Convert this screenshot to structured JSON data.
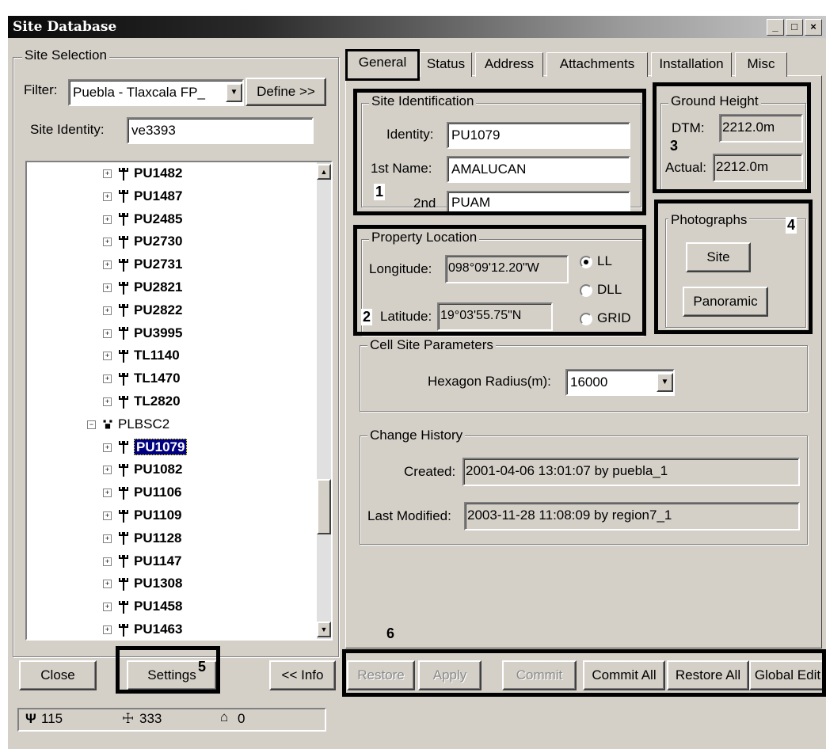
{
  "window": {
    "title": "Site Database"
  },
  "site_selection": {
    "group_label": "Site Selection",
    "filter_label": "Filter:",
    "filter_value": "Puebla - Tlaxcala FP_",
    "define_label": "Define >>",
    "identity_label": "Site Identity:",
    "identity_value": "ve3393"
  },
  "tree": {
    "items_top": [
      "PU1482",
      "PU1487",
      "PU2485",
      "PU2730",
      "PU2731",
      "PU2821",
      "PU2822",
      "PU3995",
      "TL1140",
      "TL1470",
      "TL2820"
    ],
    "parent": "PLBSC2",
    "selected": "PU1079",
    "items_bottom": [
      "PU1082",
      "PU1106",
      "PU1109",
      "PU1128",
      "PU1147",
      "PU1308",
      "PU1458",
      "PU1463"
    ]
  },
  "left_buttons": {
    "close": "Close",
    "settings": "Settings",
    "info": "<< Info"
  },
  "status_bar": {
    "sites": "115",
    "switches": "333",
    "buildings": "0"
  },
  "tabs": [
    "General",
    "Status",
    "Address",
    "Attachments",
    "Installation",
    "Misc"
  ],
  "site_identification": {
    "label": "Site Identification",
    "identity_label": "Identity:",
    "identity": "PU1079",
    "first_name_label": "1st Name:",
    "first_name": "AMALUCAN",
    "second_label": "2nd",
    "second": "PUAM"
  },
  "ground_height": {
    "label": "Ground Height",
    "dtm_label": "DTM:",
    "dtm": "2212.0m",
    "actual_label": "Actual:",
    "actual": "2212.0m"
  },
  "property_location": {
    "label": "Property Location",
    "longitude_label": "Longitude:",
    "longitude": "098°09'12.20\"W",
    "latitude_label": "Latitude:",
    "latitude": "19°03'55.75\"N",
    "options": [
      "LL",
      "DLL",
      "GRID"
    ]
  },
  "photographs": {
    "label": "Photographs",
    "site": "Site",
    "panoramic": "Panoramic"
  },
  "cell_site": {
    "label": "Cell Site Parameters",
    "radius_label": "Hexagon Radius(m):",
    "radius": "16000"
  },
  "change_history": {
    "label": "Change History",
    "created_label": "Created:",
    "created": "2001-04-06 13:01:07 by puebla_1",
    "modified_label": "Last Modified:",
    "modified": "2003-11-28 11:08:09 by region7_1"
  },
  "actions": {
    "restore": "Restore",
    "apply": "Apply",
    "commit": "Commit",
    "commit_all": "Commit All",
    "restore_all": "Restore All",
    "global_edit": "Global Edit"
  },
  "callouts": [
    "1",
    "2",
    "3",
    "4",
    "5",
    "6"
  ]
}
